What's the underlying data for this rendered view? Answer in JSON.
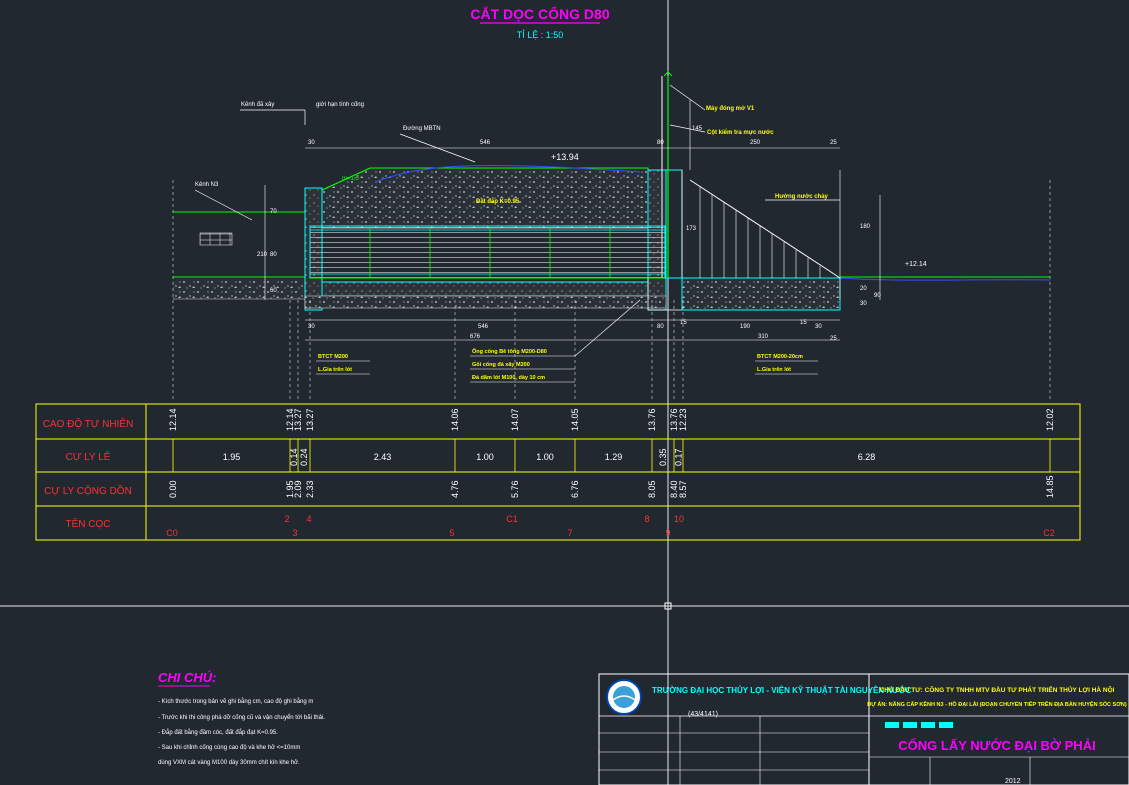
{
  "drawing": {
    "title": "CẮT DỌC CỐNG D80",
    "scale": "TỈ LỆ : 1:50",
    "annotations": {
      "kenh_da_xay": "Kênh đã xây",
      "gioi_han": "giới hạn tính cống",
      "duong_mbtn": "Đường MBTN",
      "kenh_n3": "Kênh N3",
      "cao_do_top": "+13.94",
      "cao_do_right": "+12.14",
      "dat_dap": "Đất đắp K=0.95",
      "may_dong_mo": "Máy đóng mở V1",
      "cot_kiem_tra": "Cột kiểm tra mực nước",
      "huong_nuoc": "Hướng nước chảy",
      "mai": "m=1.5",
      "btct_left_1": "BTCT M200",
      "btct_left_2": "L.Gia trên lót",
      "ong_cong_1": "Ống cống Bê tông M200-D80",
      "ong_cong_2": "Gối cống đá xây M200",
      "ong_cong_3": "Đá dăm lót M100, dày 10 cm",
      "btct_right_1": "BTCT M200-20cm",
      "btct_right_2": "L.Gia trên lót"
    },
    "dims_top": [
      "30",
      "546",
      "80",
      "25",
      "250",
      "145"
    ],
    "dims_vertical_left": [
      "70",
      "80",
      "210",
      "60"
    ],
    "dims_vertical_right": [
      "173",
      "180",
      "20",
      "30",
      "90"
    ],
    "dims_bottom_row1": [
      "30",
      "546",
      "80",
      "15",
      "190",
      "15",
      "30"
    ],
    "dims_bottom_row2": [
      "676",
      "310",
      "25"
    ]
  },
  "table": {
    "row_labels": [
      "CAO ĐỘ TỰ NHIÊN",
      "CỰ LY LẺ",
      "CỰ LY CỘNG DỒN",
      "TÊN CỌC"
    ],
    "cao_do": [
      "12.14",
      "12.14",
      "13.27",
      "13.27",
      "14.06",
      "14.07",
      "14.05",
      "13.76",
      "13.76",
      "12.23",
      "12.02"
    ],
    "cu_ly_le": [
      "1.95",
      "0.14",
      "0.24",
      "2.43",
      "1.00",
      "1.00",
      "1.29",
      "0.35",
      "0.17",
      "6.28"
    ],
    "cong_don": [
      "0.00",
      "1.95",
      "2.09",
      "2.33",
      "4.76",
      "5.76",
      "6.76",
      "8.05",
      "8.40",
      "8.57",
      "14.85"
    ],
    "ten_coc_top": [
      "2",
      "4",
      "C1",
      "8",
      "10"
    ],
    "ten_coc_bottom": [
      "C0",
      "3",
      "5",
      "7",
      "9",
      "C2"
    ]
  },
  "notes": {
    "heading": "CHI CHÚ:",
    "lines": [
      "- Kích thước trong bản vẽ ghi bằng cm, cao độ ghi bằng m",
      "- Trước khi thi công phá dỡ cống cũ và vận chuyển tới bãi thải.",
      "- Đắp đất bằng đầm cóc, đất đắp đạt K=0.95.",
      "- Sau khi chỉnh cống cùng cao độ và khe hở <=10mm",
      "  dùng VXM cát vàng M100 dày 30mm chít kín khe hở."
    ]
  },
  "title_block": {
    "school": "TRƯỜNG ĐẠI HỌC THỦY LỢI - VIỆN KỸ THUẬT TÀI NGUYÊN NƯỚC",
    "owner": "CHỦ ĐẦU TƯ: CÔNG TY TNHH MTV ĐẦU TƯ PHÁT TRIỂN THỦY LỢI HÀ NỘI",
    "project": "DỰ ÁN: NÂNG CẤP KÊNH N3 - HỒ ĐẠI LẢI (ĐOẠN CHUYỂN TIẾP TRÊN ĐỊA BÀN HUYỆN SÓC SƠN)",
    "drawing_name": "CỐNG LẤY NƯỚC ĐẠI BỜ PHẢI",
    "code": "(43/4141)",
    "year": "2012"
  },
  "colors": {
    "background": "#212830",
    "magenta": "#ff00ff",
    "cyan": "#00ffff",
    "yellow": "#ffff00",
    "green": "#00ff00",
    "red": "#ff3030",
    "white": "#ffffff",
    "blue": "#3050ff"
  }
}
